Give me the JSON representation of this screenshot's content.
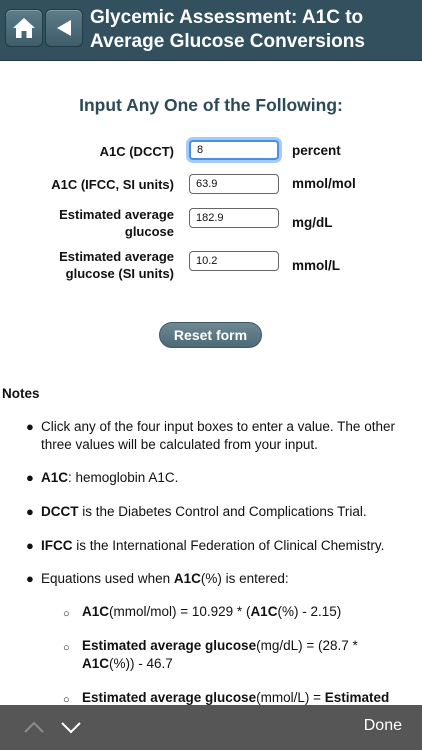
{
  "header": {
    "title": "Glycemic Assessment: A1C to Average Glucose Conversions",
    "home_icon": "home-icon",
    "back_icon": "back-arrow-icon"
  },
  "form": {
    "heading": "Input Any One of the Following:",
    "fields": [
      {
        "label": "A1C (DCCT)",
        "value": "8",
        "unit": "percent"
      },
      {
        "label": "A1C (IFCC, SI units)",
        "value": "63.9",
        "unit": "mmol/mol"
      },
      {
        "label": "Estimated average glucose",
        "value": "182.9",
        "unit": "mg/dL"
      },
      {
        "label": "Estimated average glucose (SI units)",
        "value": "10.2",
        "unit": "mmol/L"
      }
    ],
    "reset_label": "Reset form"
  },
  "notes": {
    "title": "Notes",
    "n1": "Click any of the four input boxes to enter a value. The other three values will be calculated from your input.",
    "n2_bold": "A1C",
    "n2_rest": ": hemoglobin A1C.",
    "n3_bold": "DCCT",
    "n3_rest": " is the Diabetes Control and Complications Trial.",
    "n4_bold": "IFCC",
    "n4_rest": " is the International Federation of Clinical Chemistry.",
    "n5_pre": "Equations used when ",
    "n5_bold": "A1C",
    "n5_post": "(%) is entered:",
    "s1_b1": "A1C",
    "s1_t1": "(mmol/mol) = 10.929 * (",
    "s1_b2": "A1C",
    "s1_t2": "(%) - 2.15)",
    "s2_b1": "Estimated average glucose",
    "s2_t1": "(mg/dL) = (28.7 * ",
    "s2_b2": "A1C",
    "s2_t2": "(%)) - 46.7",
    "s3_b1": "Estimated average glucose",
    "s3_t1": "(mmol/L) = ",
    "s3_b2": "Estimated"
  },
  "toolbar": {
    "done_label": "Done",
    "up_icon": "chevron-up-icon",
    "down_icon": "chevron-down-icon"
  }
}
